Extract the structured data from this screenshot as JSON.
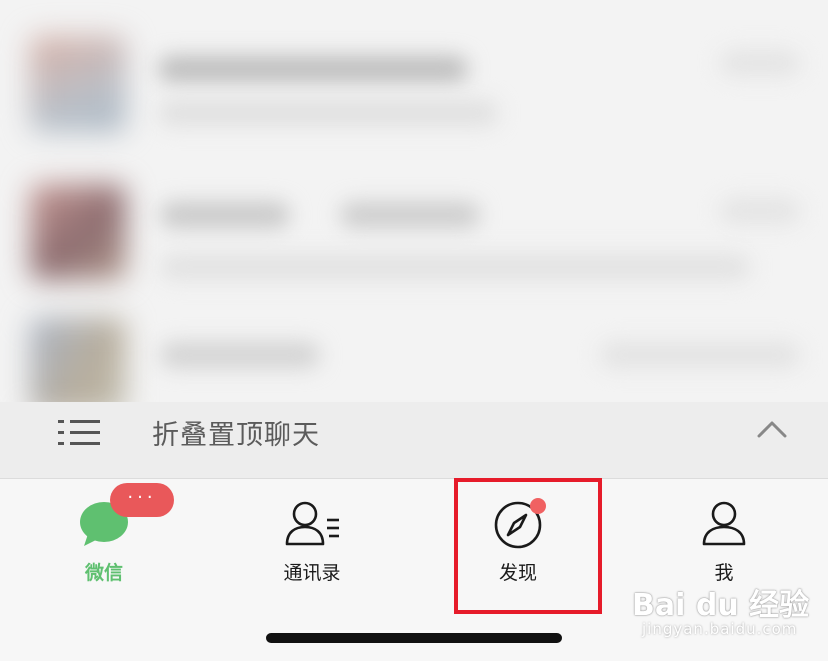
{
  "folded_pinned": {
    "label": "折叠置顶聊天"
  },
  "tabs": [
    {
      "label": "微信",
      "icon": "chat-bubble-icon",
      "active": true,
      "badge": "···"
    },
    {
      "label": "通讯录",
      "icon": "contacts-icon",
      "active": false
    },
    {
      "label": "发现",
      "icon": "compass-icon",
      "active": false,
      "has_dot": true,
      "highlighted": true
    },
    {
      "label": "我",
      "icon": "person-icon",
      "active": false
    }
  ],
  "watermark": {
    "main": "Bai du 经验",
    "sub": "jingyan.baidu.com"
  },
  "colors": {
    "accent_green": "#5fc070",
    "badge_red": "#e9585a",
    "highlight_red": "#e61b2a"
  }
}
